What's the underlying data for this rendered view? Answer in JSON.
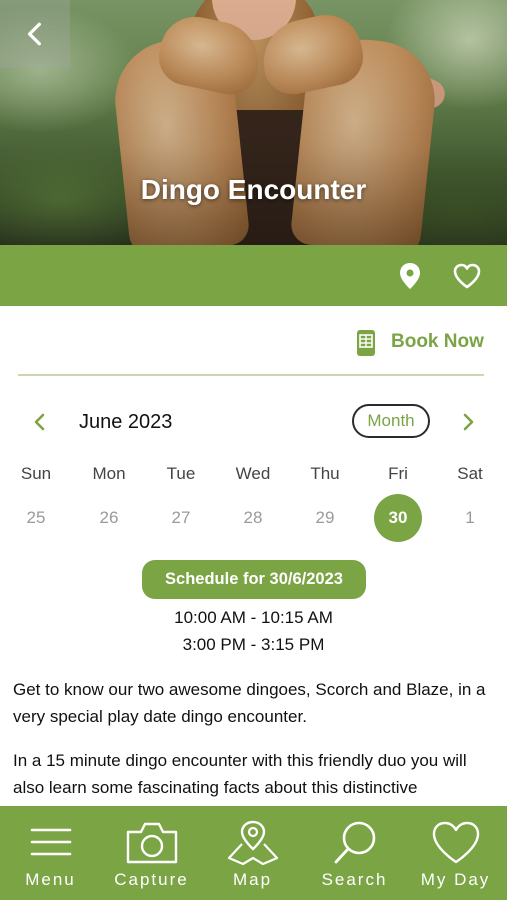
{
  "header": {
    "title": "Dingo Encounter",
    "back_icon": "chevron-left-icon"
  },
  "actions": {
    "location_icon": "map-pin-icon",
    "favorite_icon": "heart-outline-icon",
    "book_icon": "booking-icon",
    "book_label": "Book Now"
  },
  "calendar": {
    "month_label": "June 2023",
    "mode_label": "Month",
    "prev_icon": "chevron-left-icon",
    "next_icon": "chevron-right-icon",
    "weekdays": [
      "Sun",
      "Mon",
      "Tue",
      "Wed",
      "Thu",
      "Fri",
      "Sat"
    ],
    "days": [
      "25",
      "26",
      "27",
      "28",
      "29",
      "30",
      "1"
    ],
    "selected_index": 5
  },
  "schedule": {
    "title": "Schedule for 30/6/2023",
    "times": [
      "10:00 AM - 10:15 AM",
      "3:00 PM - 3:15 PM"
    ]
  },
  "description": {
    "paragraphs": [
      "Get to know our two awesome dingoes, Scorch and Blaze, in a very special play date dingo encounter.",
      "In a 15 minute dingo encounter with this friendly duo you will also learn some fascinating facts about this distinctive"
    ]
  },
  "bottom_nav": {
    "items": [
      {
        "label": "Menu",
        "icon": "hamburger-menu-icon"
      },
      {
        "label": "Capture",
        "icon": "camera-icon"
      },
      {
        "label": "Map",
        "icon": "map-icon"
      },
      {
        "label": "Search",
        "icon": "search-icon"
      },
      {
        "label": "My Day",
        "icon": "heart-outline-icon"
      }
    ]
  },
  "colors": {
    "brand_green": "#7ba445",
    "divider": "#c9d8b0"
  }
}
